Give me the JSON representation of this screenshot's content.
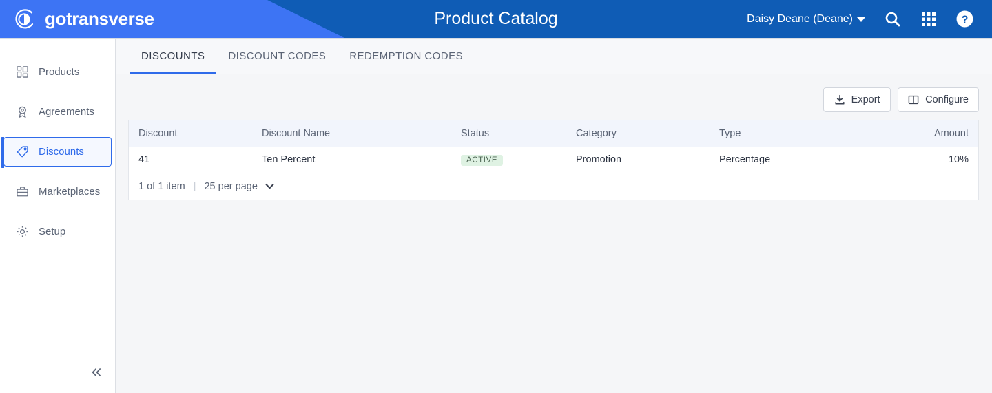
{
  "header": {
    "brand_name": "gotransverse",
    "logo_icon": "gotransverse-circle-logo",
    "title": "Product Catalog",
    "user_name": "Daisy Deane (Deane)",
    "icons": [
      {
        "name": "search-icon",
        "label": "Search"
      },
      {
        "name": "apps-grid-icon",
        "label": "Apps"
      },
      {
        "name": "help-circle-icon",
        "label": "Help"
      }
    ],
    "colors": {
      "primary": "#0f5cb5",
      "accent": "#3d74f4"
    }
  },
  "sidebar": {
    "items": [
      {
        "label": "Products",
        "icon": "products-grid-icon",
        "active": false
      },
      {
        "label": "Agreements",
        "icon": "agreement-badge-icon",
        "active": false
      },
      {
        "label": "Discounts",
        "icon": "discount-tag-icon",
        "active": true
      },
      {
        "label": "Marketplaces",
        "icon": "marketplace-briefcase-icon",
        "active": false
      },
      {
        "label": "Setup",
        "icon": "setup-gear-icon",
        "active": false
      }
    ],
    "collapse_icon": "chevron-double-left-icon"
  },
  "main": {
    "tabs": [
      {
        "label": "DISCOUNTS",
        "active": true
      },
      {
        "label": "DISCOUNT CODES",
        "active": false
      },
      {
        "label": "REDEMPTION CODES",
        "active": false
      }
    ],
    "toolbar": {
      "export_label": "Export",
      "export_icon": "download-icon",
      "configure_label": "Configure",
      "configure_icon": "columns-layout-icon"
    },
    "table": {
      "columns": [
        {
          "key": "discount",
          "label": "Discount",
          "align": "left"
        },
        {
          "key": "name",
          "label": "Discount Name",
          "align": "left"
        },
        {
          "key": "status",
          "label": "Status",
          "align": "left"
        },
        {
          "key": "category",
          "label": "Category",
          "align": "left"
        },
        {
          "key": "type",
          "label": "Type",
          "align": "left"
        },
        {
          "key": "amount",
          "label": "Amount",
          "align": "right"
        }
      ],
      "rows": [
        {
          "discount": "41",
          "name": "Ten Percent",
          "status": "ACTIVE",
          "category": "Promotion",
          "type": "Percentage",
          "amount": "10%"
        }
      ]
    },
    "footer": {
      "item_count": "1 of 1 item",
      "separator": "|",
      "per_page": "25 per page",
      "per_page_icon": "chevron-down-icon"
    },
    "colors": {
      "badge_active_bg": "#dff2e3",
      "badge_active_text": "#4c6452"
    }
  }
}
